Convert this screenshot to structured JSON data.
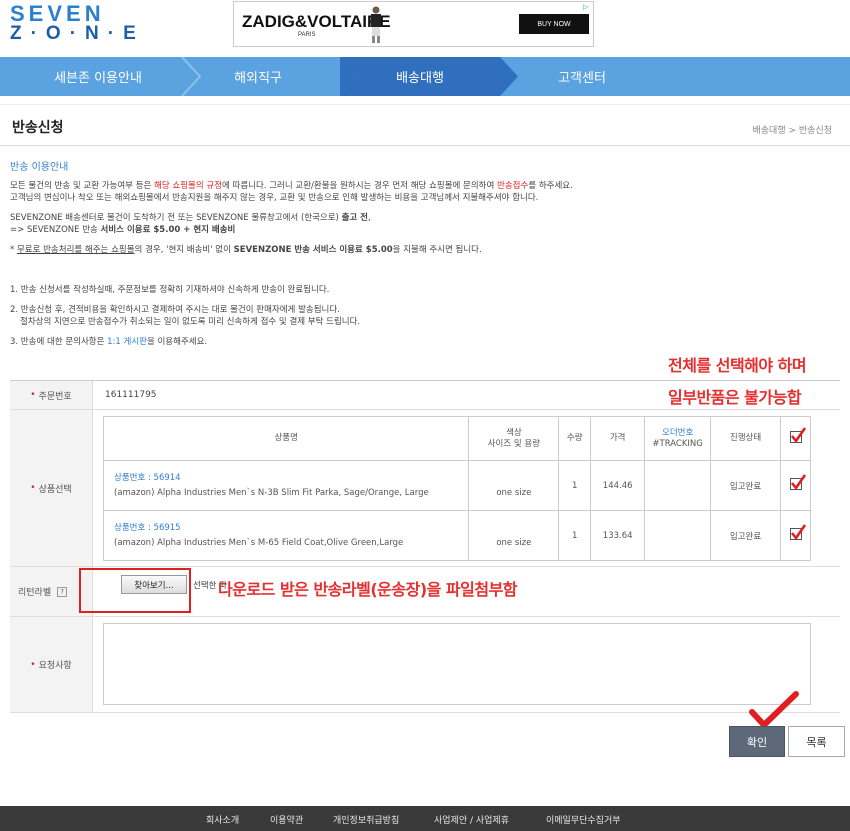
{
  "logo": {
    "line1": "SEVEN",
    "line2": "Z·O·N·E"
  },
  "ad": {
    "brand": "ZADIG&VOLTAIRE",
    "sub": "PARIS",
    "button": "BUY NOW",
    "adchoices": "▷"
  },
  "nav": {
    "items": [
      {
        "label": "세븐존 이용안내"
      },
      {
        "label": "해외직구"
      },
      {
        "label": "배송대행"
      },
      {
        "label": "고객센터"
      }
    ]
  },
  "page": {
    "title": "반송신청",
    "breadcrumb": "배송대행 > 반송신청"
  },
  "guide": {
    "title": "반송 이용안내",
    "p1_a": "모든 물건의 반송 및 교환 가능여부 등은 ",
    "p1_b": "해당 쇼핑몰의 규정",
    "p1_c": "에 따릅니다. 그러니 교환/환불을 원하시는 경우 먼저 해당 쇼핑몰에 문의하여 ",
    "p1_d": "반송접수",
    "p1_e": "를 하주세요.",
    "p1_line2": "고객님의 변심이나 착오 또는 해외쇼핑몰에서 반송지원을 해주지 않는 경우, 교환 및 반송으로 인해 발생하는 비용을 고객님께서 지불해주셔야 합니다.",
    "p2_a": "SEVENZONE 배송센터로 물건이 도착하기 전 또는 SEVENZONE 물류창고에서 (한국으로) ",
    "p2_b": "출고 전",
    "p2_c": ",",
    "p2_line2_a": "=> SEVENZONE 반송 ",
    "p2_line2_b": "서비스 이용료 $5.00 + 현지 배송비",
    "p3_a": "* ",
    "p3_b": "무료로 반송처리를 해주는 쇼핑몰",
    "p3_c": "의 경우, '현지 배송비' 없이 ",
    "p3_d": "SEVENZONE 반송 서비스 이용료 $5.00",
    "p3_e": "을 지불해 주시면 됩니다.",
    "n1": "1. 반송 신청서를 작성하실때, 주문정보를 정확히 기재하셔야 신속하게 반송이 완료됩니다.",
    "n2": "2. 반송신청 후, 견적비용을 확인하시고 결제하여 주시는 대로 물건이 판매자에게 발송됩니다.",
    "n2_line2": "절차상의 지연으로 반송접수가 취소되는 일이 없도록 미리 신속하게 접수 및 결제 부탁 드립니다.",
    "n3_a": "3. 반송에 대한 문의사항은 ",
    "n3_b": "1:1 게시판",
    "n3_c": "을 이용해주세요."
  },
  "annotations": {
    "line1": "전체를 선택해야 하며",
    "line2": "일부반품은 불가능합",
    "line3": "다운로드 받은 반송라벨(운송장)을 파일첨부함"
  },
  "form": {
    "order_label": "주문번호",
    "order_value": "161111795",
    "select_label": "상품선택",
    "headers": {
      "product": "상품명",
      "option_line1": "색상",
      "option_line2": "사이즈 및 용량",
      "qty": "수량",
      "price": "가격",
      "order_no": "오더번호",
      "tracking": "#TRACKING",
      "status": "진행상태"
    },
    "rows": [
      {
        "product_no": "상품번호 : 56914",
        "product_name": "(amazon) Alpha Industries Men`s N-3B Slim Fit Parka, Sage/Orange, Large",
        "option": "one size",
        "qty": "1",
        "price": "144.46",
        "tracking": "",
        "status": "입고완료"
      },
      {
        "product_no": "상품번호 : 56915",
        "product_name": "(amazon) Alpha Industries Men`s M-65 Field Coat,Olive Green,Large",
        "option": "one size",
        "qty": "1",
        "price": "133.64",
        "tracking": "",
        "status": "입고완료"
      }
    ],
    "label_label": "리턴라벨",
    "help": "?",
    "file_button": "찾아보기...",
    "file_text": "선택한 파",
    "request_label": "요청사항",
    "request_value": ""
  },
  "buttons": {
    "confirm": "확인",
    "list": "목록"
  },
  "footer": {
    "links": [
      "회사소개",
      "이용약관",
      "개인정보취급방침",
      "사업제안 / 사업제휴",
      "이메일무단수집거부"
    ]
  },
  "colors": {
    "nav": "#5aa3e0",
    "nav_active": "#2f6fbe",
    "annotation": "#e53030",
    "link_blue": "#2f7fcf"
  }
}
